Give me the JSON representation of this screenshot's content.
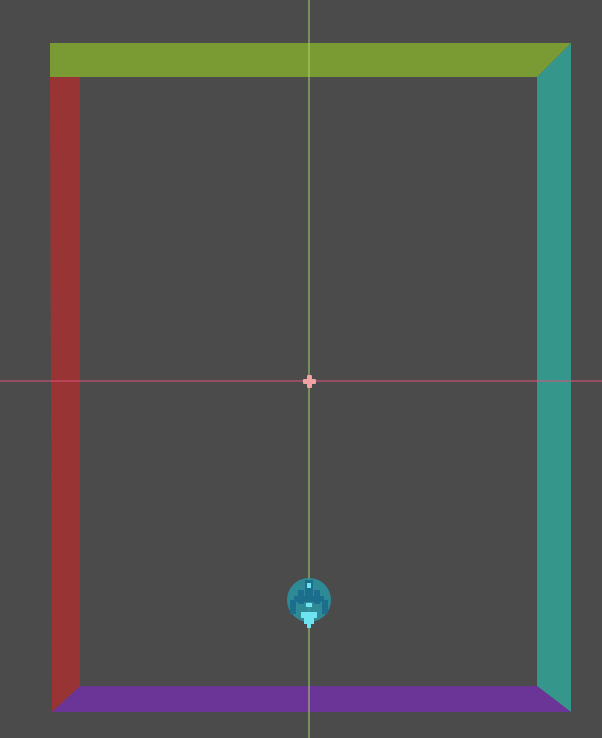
{
  "scene": {
    "background_color": "#4b4b4b",
    "walls": {
      "top": {
        "color": "#7a9a34"
      },
      "left": {
        "color": "#993434"
      },
      "right": {
        "color": "#35968c"
      },
      "bottom": {
        "color": "#6a3596"
      }
    },
    "axis_x_color": "#e0507a",
    "axis_y_color": "#a6d46a",
    "origin_color": "#f0a3a3",
    "player": {
      "icon": "spaceship-icon",
      "shield_color": "#2a95a5",
      "body_color": "#1b6f8c",
      "highlight_color": "#6fe3f0"
    }
  }
}
